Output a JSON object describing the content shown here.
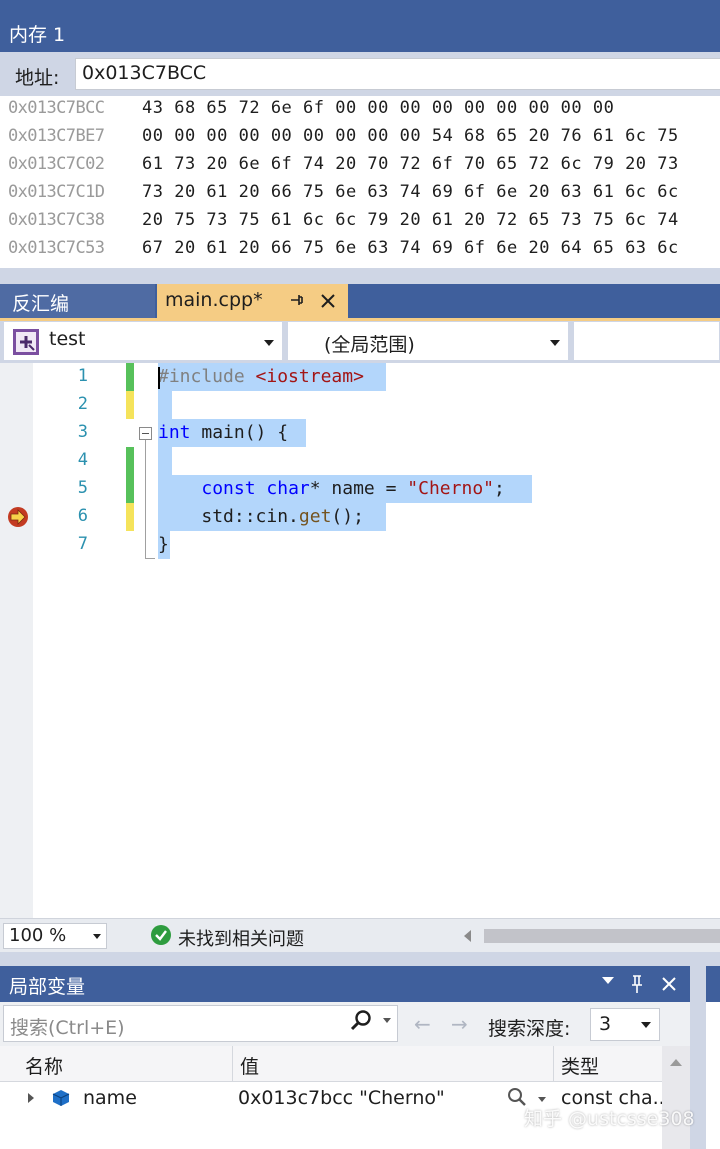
{
  "memory": {
    "title": "内存 1",
    "address_label": "地址:",
    "address_value": "0x013C7BCC",
    "rows": [
      {
        "address": "0x013C7BCC",
        "bytes": "43 68 65 72 6e 6f 00 00 00 00 00 00 00 00 00"
      },
      {
        "address": "0x013C7BE7",
        "bytes": "00 00 00 00 00 00 00 00 00 54 68 65 20 76 61 6c 75"
      },
      {
        "address": "0x013C7C02",
        "bytes": "61 73 20 6e 6f 74 20 70 72 6f 70 65 72 6c 79 20 73"
      },
      {
        "address": "0x013C7C1D",
        "bytes": "73 20 61 20 66 75 6e 63 74 69 6f 6e 20 63 61 6c 6c"
      },
      {
        "address": "0x013C7C38",
        "bytes": "20 75 73 75 61 6c 6c 79 20 61 20 72 65 73 75 6c 74"
      },
      {
        "address": "0x013C7C53",
        "bytes": "67 20 61 20 66 75 6e 63 74 69 6f 6e 20 64 65 63 6c"
      }
    ]
  },
  "tabs": {
    "disassembly": "反汇编",
    "active": "main.cpp*"
  },
  "navbar": {
    "project": "test",
    "scope": "(全局范围)"
  },
  "editor": {
    "line_numbers": [
      "1",
      "2",
      "3",
      "4",
      "5",
      "6",
      "7"
    ],
    "lines": {
      "l1_pp": "#include",
      "l1_header": "<iostream>",
      "l3_kw": "int",
      "l3_rest": " main() {",
      "l5_const": "const",
      "l5_char": "char",
      "l5_mid": "* name = ",
      "l5_str": "\"Cherno\"",
      "l5_end": ";",
      "l6_pre": "std::cin.",
      "l6_fn": "get",
      "l6_end": "();",
      "l7": "}"
    },
    "change_marks": [
      "green",
      "yellow",
      "none",
      "green",
      "green",
      "yellow",
      "none"
    ],
    "current_line": 6
  },
  "status": {
    "zoom": "100 %",
    "message": "未找到相关问题"
  },
  "locals": {
    "title": "局部变量",
    "search_placeholder": "搜索(Ctrl+E)",
    "depth_label": "搜索深度:",
    "depth_value": "3",
    "columns": [
      "名称",
      "值",
      "类型"
    ],
    "rows": [
      {
        "name": "name",
        "value": "0x013c7bcc \"Cherno\"",
        "type": "const cha..."
      }
    ]
  },
  "watermark": "知乎 @ustcsse308",
  "colors": {
    "title_bar": "#3f5f9c",
    "active_tab": "#f5cc84",
    "selection": "#b3d6fb",
    "keyword": "#0000ff",
    "string": "#a31515",
    "line_number": "#2b91af",
    "change_green": "#57c15b",
    "change_yellow": "#f5e35b"
  },
  "icons": [
    "pin-icon",
    "close-icon",
    "project-icon",
    "breakpoint-arrow-icon",
    "fold-icon",
    "check-icon",
    "search-icon",
    "magnifier-icon",
    "variable-icon"
  ]
}
